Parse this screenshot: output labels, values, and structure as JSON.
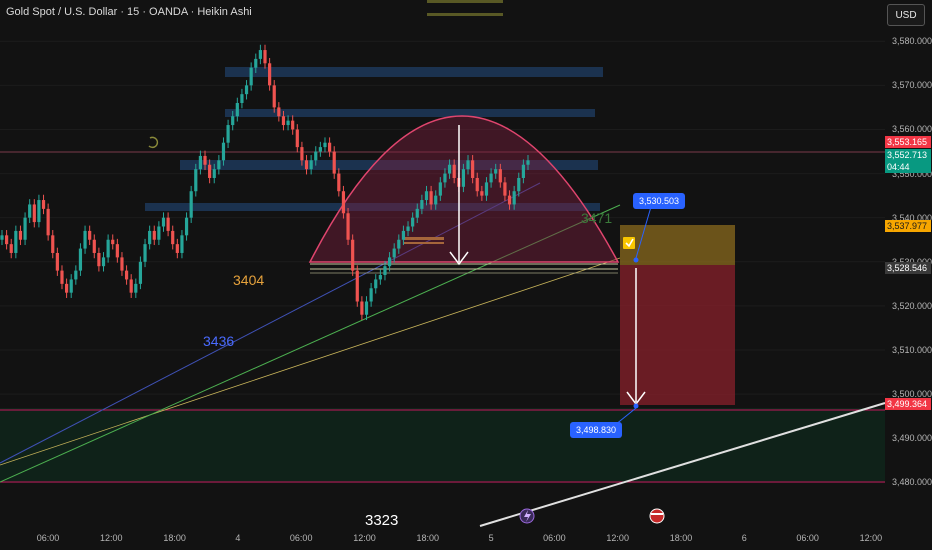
{
  "header": {
    "title": "Gold Spot / U.S. Dollar · 15 · OANDA · Heikin Ashi",
    "currency_button": "USD"
  },
  "chart_data": {
    "type": "candlestick",
    "title": "Gold Spot / U.S. Dollar · 15 · OANDA · Heikin Ashi",
    "y_ticks": [
      "3,580.000",
      "3,570.000",
      "3,560.000",
      "3,550.000",
      "3,540.000",
      "3,530.000",
      "3,520.000",
      "3,510.000",
      "3,500.000",
      "3,490.000",
      "3,480.000"
    ],
    "ylim": [
      3476,
      3583
    ],
    "x_ticks": [
      "06:00",
      "12:00",
      "18:00",
      "4",
      "06:00",
      "12:00",
      "18:00",
      "5",
      "06:00",
      "12:00",
      "18:00",
      "6",
      "06:00",
      "12:00"
    ],
    "price_labels": {
      "bid": {
        "value": "3,553.165",
        "color": "#f23645"
      },
      "last": {
        "value": "3,552.713",
        "countdown": "04:44",
        "color": "#089981"
      },
      "entry": {
        "value": "3,537.977",
        "color": "#f7a600"
      },
      "mid": {
        "value": "3,528.546",
        "color": "#3a3a3a"
      },
      "target": {
        "value": "3,499.364",
        "color": "#f23645"
      }
    },
    "annotations": {
      "level_3404": "3404",
      "level_3436": "3436",
      "level_3471": "3471",
      "level_3323": "3323",
      "entry_tip": "3,530.503",
      "target_tip": "3,498.830"
    },
    "colors": {
      "up": "#26a69a",
      "down": "#ef5350",
      "background": "#121212"
    },
    "candles": {
      "up": "#26a69a",
      "down": "#ef5350",
      "closes": [
        3536,
        3534,
        3532,
        3537,
        3535,
        3540,
        3543,
        3539,
        3544,
        3542,
        3536,
        3532,
        3528,
        3525,
        3523,
        3526,
        3528,
        3533,
        3537,
        3535,
        3532,
        3529,
        3531,
        3535,
        3534,
        3531,
        3528,
        3526,
        3523,
        3525,
        3530,
        3534,
        3537,
        3535,
        3538,
        3540,
        3537,
        3534,
        3532,
        3536,
        3540,
        3546,
        3551,
        3554,
        3552,
        3549,
        3551,
        3553,
        3557,
        3561,
        3563,
        3566,
        3568,
        3570,
        3574,
        3576,
        3578,
        3575,
        3570,
        3565,
        3563,
        3561,
        3562,
        3560,
        3556,
        3553,
        3551,
        3553,
        3555,
        3556,
        3557,
        3555,
        3550,
        3546,
        3541,
        3535,
        3528,
        3521,
        3518,
        3521,
        3524,
        3526,
        3527,
        3529,
        3531,
        3533,
        3535,
        3537,
        3538,
        3540,
        3542,
        3544,
        3546,
        3543,
        3545,
        3548,
        3550,
        3552,
        3549,
        3547,
        3551,
        3553,
        3549,
        3546,
        3545,
        3548,
        3550,
        3551,
        3548,
        3545,
        3543,
        3546,
        3549,
        3552,
        3553
      ]
    }
  }
}
